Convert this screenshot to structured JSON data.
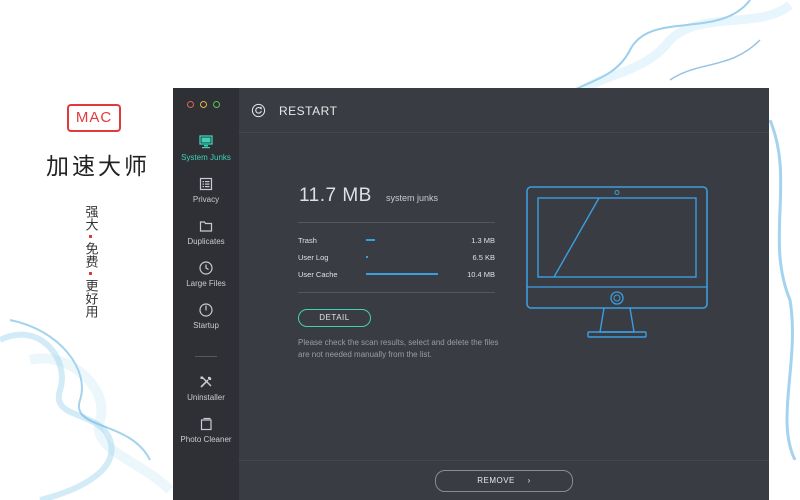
{
  "promo": {
    "badge": "MAC",
    "title": "加速大师",
    "taglines": [
      "强大",
      "免费",
      "更好用"
    ]
  },
  "window": {
    "header": {
      "title": "RESTART"
    },
    "sidebar": {
      "items": [
        {
          "label": "System Junks",
          "icon": "monitor-icon",
          "active": true
        },
        {
          "label": "Privacy",
          "icon": "list-icon",
          "active": false
        },
        {
          "label": "Duplicates",
          "icon": "folder-icon",
          "active": false
        },
        {
          "label": "Large Files",
          "icon": "clock-icon",
          "active": false
        },
        {
          "label": "Startup",
          "icon": "power-icon",
          "active": false
        },
        {
          "label": "Uninstaller",
          "icon": "tools-icon",
          "active": false
        },
        {
          "label": "Photo Cleaner",
          "icon": "photos-icon",
          "active": false
        }
      ]
    },
    "summary": {
      "size": "11.7 MB",
      "label": "system junks"
    },
    "rows": [
      {
        "name": "Trash",
        "size": "1.3 MB",
        "fraction": 0.125
      },
      {
        "name": "User Log",
        "size": "6.5 KB",
        "fraction": 0.01
      },
      {
        "name": "User Cache",
        "size": "10.4 MB",
        "fraction": 1.0
      }
    ],
    "detail_button": "DETAIL",
    "hint": "Please check the scan results, select and delete the files are not needed manually from the list.",
    "remove_button": "REMOVE",
    "colors": {
      "accent": "#3fd1b5",
      "bar": "#3a9ee0",
      "monitor": "#3a9ee0",
      "badge": "#e23a3a"
    }
  }
}
